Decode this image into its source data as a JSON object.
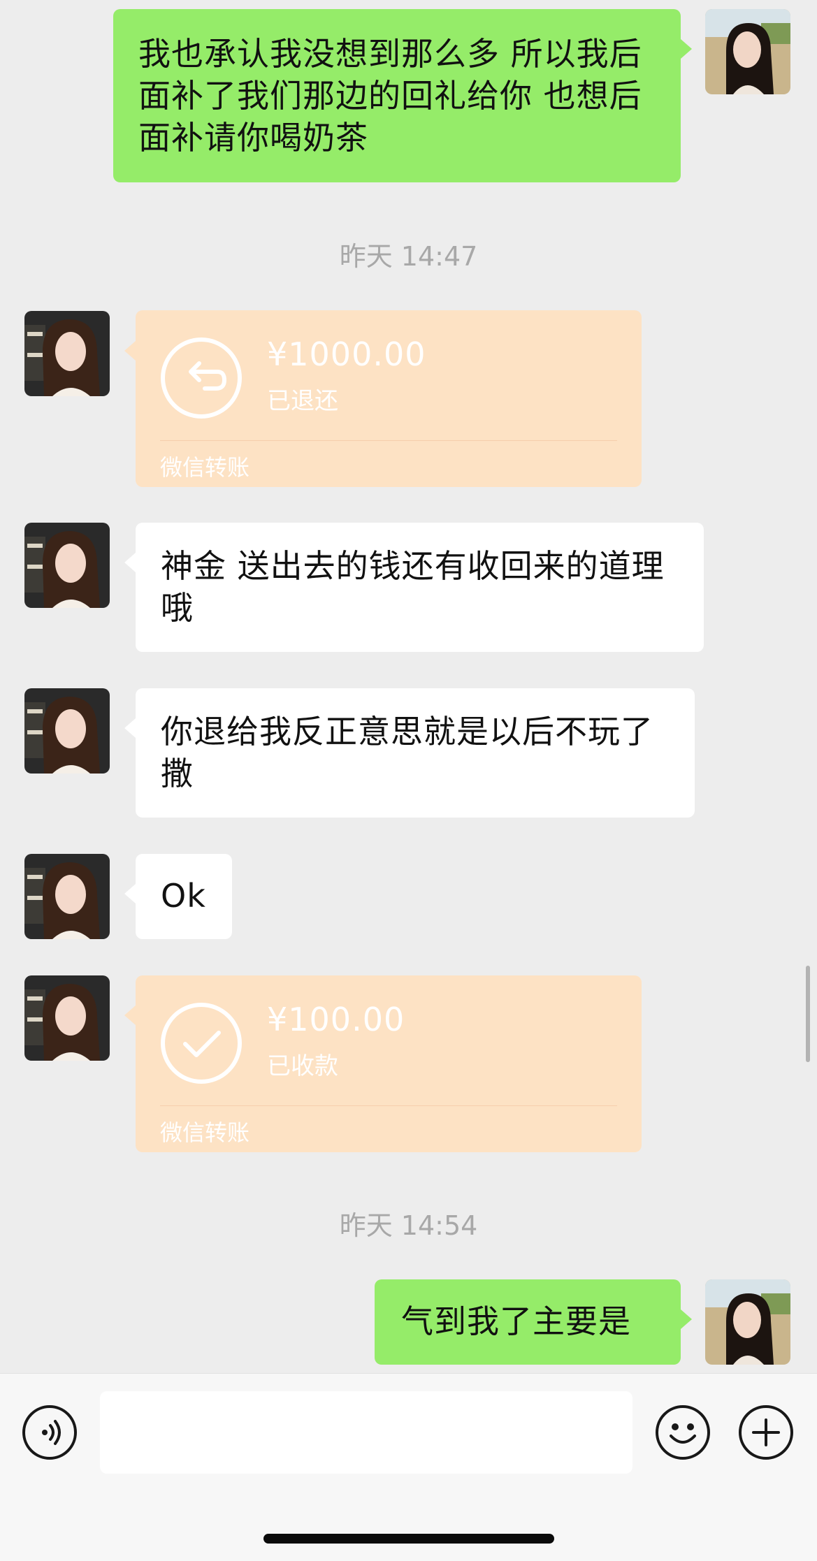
{
  "messages": {
    "m1": "我也承认我没想到那么多 所以我后面补了我们那边的回礼给你 也想后面补请你喝奶茶",
    "m2": "神金 送出去的钱还有收回来的道理哦",
    "m3": "你退给我反正意思就是以后不玩了撒",
    "m4": "Ok",
    "m5": "气到我了主要是"
  },
  "timestamps": {
    "t1": "昨天 14:47",
    "t2": "昨天 14:54"
  },
  "transfers": {
    "refund": {
      "amount": "¥1000.00",
      "status": "已退还",
      "label": "微信转账",
      "icon": "return-arrow-icon"
    },
    "received": {
      "amount": "¥100.00",
      "status": "已收款",
      "label": "微信转账",
      "icon": "checkmark-icon"
    }
  },
  "input_bar": {
    "voice_icon": "voice-icon",
    "emoji_icon": "emoji-icon",
    "plus_icon": "plus-icon",
    "text_value": ""
  },
  "colors": {
    "background": "#ededed",
    "outgoing_bubble": "#95ec69",
    "incoming_bubble": "#ffffff",
    "transfer_card": "#fde2c4"
  }
}
